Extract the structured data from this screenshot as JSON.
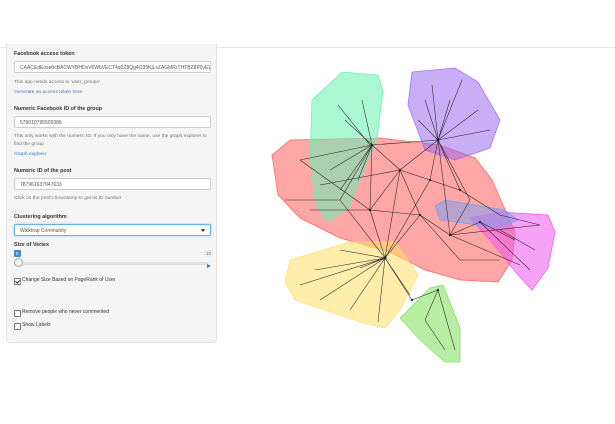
{
  "sidebar": {
    "token_label": "Facebook access token",
    "token_value": "CAACEdEose0cBACWYBHDsV6WbVECT4q0Z8Qg4O35KjLsZAGMRrTHTBZ8P0yEWX",
    "token_help": "This app needs access to 'user_groups'",
    "token_link": "Generate an access token here",
    "group_label": "Numeric Facebook ID of the group",
    "group_value": "579010795509386",
    "group_help": "This only works with the numeric ID. If you only have the name, use the graph explorer to find the group",
    "group_link": "Graph explorer",
    "post_label": "Numeric ID of the post",
    "post_value": "787961637947633",
    "post_help": "Click on the post's timestamp to get its ID number",
    "cluster_label": "Clustering algorithm",
    "cluster_value": "Walktrap Community",
    "vertex_label": "Size of Vertex",
    "vertex_min": "0",
    "vertex_max": "10",
    "vertex_value": 0,
    "cb_pagerank": "Change Size Based on PageRank of User",
    "cb_pagerank_checked": true,
    "cb_remove": "Remove people who never commented",
    "cb_remove_checked": false,
    "cb_labels": "Show Labels",
    "cb_labels_checked": false
  },
  "graph": {
    "cluster_colors": [
      "#ff5c5c",
      "#66f0b0",
      "#9b6af0",
      "#ffe066",
      "#7ee05a",
      "#ee55ee",
      "#7a9ef0"
    ]
  }
}
